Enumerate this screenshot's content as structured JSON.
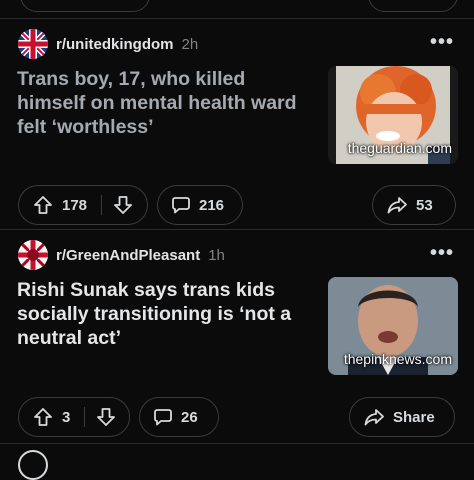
{
  "posts": [
    {
      "subreddit": "r/unitedkingdom",
      "age": "2h",
      "title": "Trans boy, 17, who killed himself on mental health ward felt ‘worthless’",
      "domain": "theguardian.com",
      "upvotes": "178",
      "comments": "216",
      "shares": "53",
      "title_color": "#a4aab0"
    },
    {
      "subreddit": "r/GreenAndPleasant",
      "age": "1h",
      "title": "Rishi Sunak says trans kids socially transitioning is ‘not a neutral act’",
      "domain": "thepinknews.com",
      "upvotes": "3",
      "comments": "26",
      "share_label": "Share",
      "title_color": "#e4e6e8"
    }
  ],
  "icons": [
    "more-dots-icon",
    "upvote-icon",
    "downvote-icon",
    "comment-icon",
    "share-icon"
  ]
}
